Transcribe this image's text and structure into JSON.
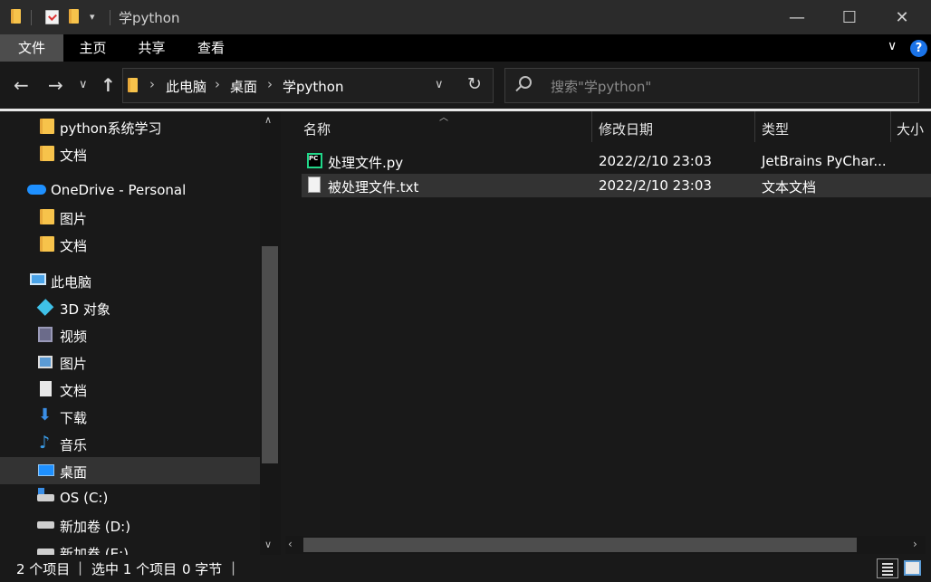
{
  "window": {
    "title": "学python",
    "minimize": "—",
    "maximize": "☐",
    "close": "✕"
  },
  "ribbon": {
    "tabs": [
      "文件",
      "主页",
      "共享",
      "查看"
    ],
    "help": "?",
    "collapse": "∨"
  },
  "address": {
    "breadcrumbs": [
      "此电脑",
      "桌面",
      "学python"
    ],
    "separator": "›",
    "dropdown": "∨",
    "refresh": "↻"
  },
  "search": {
    "placeholder": "搜索\"学python\""
  },
  "nav_pane": {
    "items": [
      {
        "label": "python系统学习",
        "icon": "folder-icon"
      },
      {
        "label": "文档",
        "icon": "folder-icon"
      },
      {
        "label": "OneDrive - Personal",
        "icon": "cloud-icon"
      },
      {
        "label": "图片",
        "icon": "folder-icon"
      },
      {
        "label": "文档",
        "icon": "folder-icon"
      },
      {
        "label": "此电脑",
        "icon": "computer-icon"
      },
      {
        "label": "3D 对象",
        "icon": "cube-icon"
      },
      {
        "label": "视频",
        "icon": "video-icon"
      },
      {
        "label": "图片",
        "icon": "pictures-icon"
      },
      {
        "label": "文档",
        "icon": "document-icon"
      },
      {
        "label": "下载",
        "icon": "download-icon"
      },
      {
        "label": "音乐",
        "icon": "music-icon"
      },
      {
        "label": "桌面",
        "icon": "desktop-icon",
        "selected": true
      },
      {
        "label": "OS (C:)",
        "icon": "system-drive-icon"
      },
      {
        "label": "新加卷 (D:)",
        "icon": "drive-icon"
      },
      {
        "label": "新加卷 (E:)",
        "icon": "drive-icon"
      }
    ]
  },
  "file_list": {
    "columns": [
      "名称",
      "修改日期",
      "类型",
      "大小"
    ],
    "rows": [
      {
        "name": "处理文件.py",
        "modified": "2022/2/10 23:03",
        "type": "JetBrains PyChar...",
        "icon": "pycharm-file-icon"
      },
      {
        "name": "被处理文件.txt",
        "modified": "2022/2/10 23:03",
        "type": "文本文档",
        "icon": "text-file-icon",
        "selected": true
      }
    ]
  },
  "status": {
    "item_count": "2 个项目",
    "selection": "选中 1 个项目",
    "size": "0 字节"
  },
  "colors": {
    "background": "#191919",
    "selected_row": "#333333",
    "accent": "#1a73e8",
    "folder": "#f7c34b"
  }
}
